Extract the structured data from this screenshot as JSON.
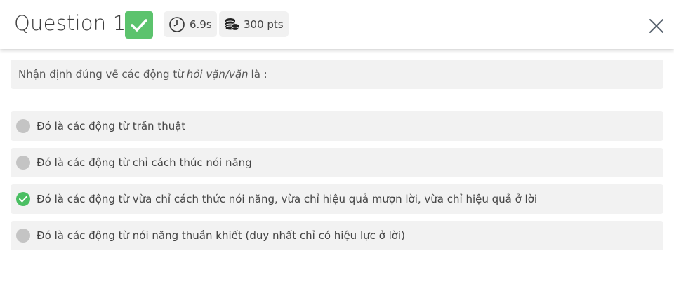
{
  "header": {
    "title": "Question 1",
    "status_icon": "check-icon",
    "time": "6.9s",
    "time_icon": "clock-icon",
    "points": "300 pts",
    "points_icon": "coins-icon",
    "close_icon": "close-icon"
  },
  "question": {
    "prefix": "Nhận định đúng về các động từ",
    "emphasis": "hỏi vặn/vặn",
    "suffix": "là :"
  },
  "options": [
    {
      "label": "Đó là các động từ trần thuật",
      "correct": false
    },
    {
      "label": "Đó là các động từ chỉ cách thức nói năng",
      "correct": false
    },
    {
      "label": "Đó là các động từ vừa chỉ cách thức nói năng, vừa chỉ hiệu quả mượn lời, vừa chỉ hiệu quả ở lời",
      "correct": true
    },
    {
      "label": "Đó là các động từ nói năng thuần khiết (duy nhất chỉ có hiệu lực ở lời)",
      "correct": false
    }
  ],
  "colors": {
    "correct_green": "#5cc36d",
    "option_bg": "#f2f2f2",
    "neutral_marker": "#c4c4c4"
  }
}
